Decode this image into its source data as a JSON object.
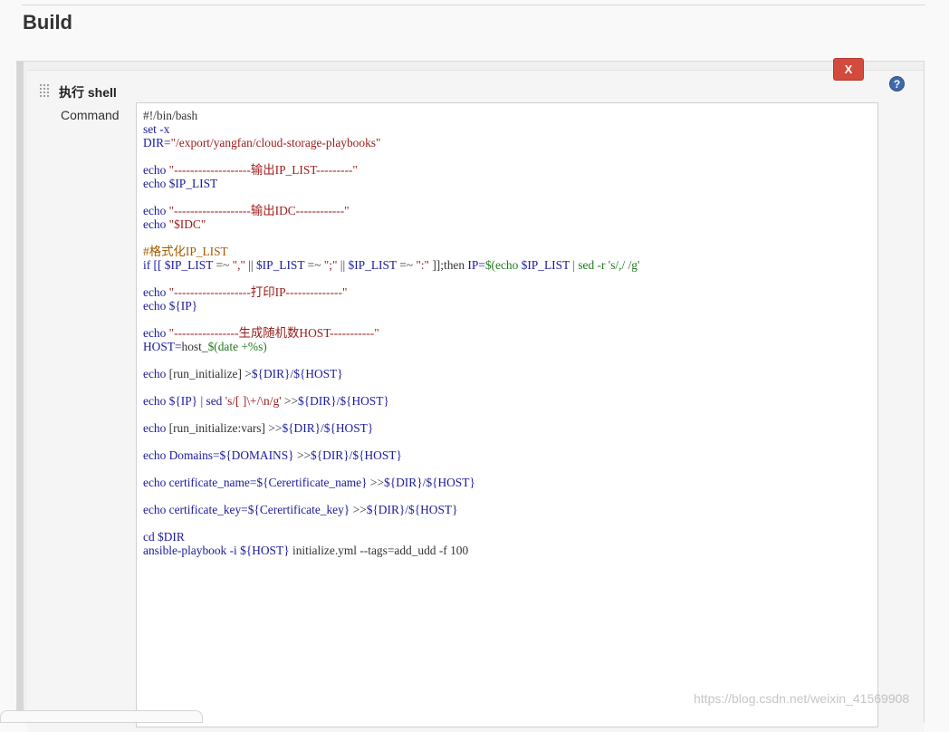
{
  "page": {
    "section_title": "Build"
  },
  "build_step": {
    "title": "执行 shell",
    "delete_label": "X",
    "help_label": "?",
    "field_label": "Command",
    "code_lines": [
      [
        [
          "p",
          "#!/bin/bash"
        ]
      ],
      [
        [
          "k",
          "set -x"
        ]
      ],
      [
        [
          "v",
          "DIR="
        ],
        [
          "s",
          "\"/export/yangfan/cloud-storage-playbooks\""
        ]
      ],
      [],
      [
        [
          "k",
          "echo "
        ],
        [
          "s",
          "\"-------------------输出IP_LIST---------\""
        ]
      ],
      [
        [
          "k",
          "echo "
        ],
        [
          "v",
          "$IP_LIST"
        ]
      ],
      [],
      [
        [
          "k",
          "echo "
        ],
        [
          "s",
          "\"-------------------输出IDC------------\""
        ]
      ],
      [
        [
          "k",
          "echo "
        ],
        [
          "s",
          "\"$IDC\""
        ]
      ],
      [],
      [
        [
          "c",
          "#格式化IP_LIST"
        ]
      ],
      [
        [
          "k",
          "if [[ "
        ],
        [
          "v",
          "$IP_LIST"
        ],
        [
          "p",
          " =~ "
        ],
        [
          "s",
          "\",\""
        ],
        [
          "p",
          " || "
        ],
        [
          "v",
          "$IP_LIST"
        ],
        [
          "p",
          " =~ "
        ],
        [
          "s",
          "\";\""
        ],
        [
          "p",
          " || "
        ],
        [
          "v",
          "$IP_LIST"
        ],
        [
          "p",
          " =~ "
        ],
        [
          "s",
          "\":\""
        ],
        [
          "p",
          " ]];then "
        ],
        [
          "v",
          "IP="
        ],
        [
          "g",
          "$(echo "
        ],
        [
          "v",
          "$IP_LIST"
        ],
        [
          "g",
          " | sed -r 's/,/ /g'"
        ]
      ],
      [],
      [
        [
          "k",
          "echo "
        ],
        [
          "s",
          "\"-------------------打印IP--------------\""
        ]
      ],
      [
        [
          "k",
          "echo "
        ],
        [
          "v",
          "${IP}"
        ]
      ],
      [],
      [
        [
          "k",
          "echo "
        ],
        [
          "s",
          "\"----------------生成随机数HOST-----------\""
        ]
      ],
      [
        [
          "v",
          "HOST="
        ],
        [
          "p",
          "host_"
        ],
        [
          "g",
          "$(date +%s)"
        ]
      ],
      [],
      [
        [
          "k",
          "echo "
        ],
        [
          "p",
          "[run_initialize] >"
        ],
        [
          "v",
          "${DIR}/${HOST}"
        ]
      ],
      [],
      [
        [
          "k",
          "echo "
        ],
        [
          "v",
          "${IP}"
        ],
        [
          "p",
          " | "
        ],
        [
          "k",
          "sed "
        ],
        [
          "s",
          "'s/[ ]\\+/\\n/g'"
        ],
        [
          "p",
          " >>"
        ],
        [
          "v",
          "${DIR}/${HOST}"
        ]
      ],
      [],
      [
        [
          "k",
          "echo "
        ],
        [
          "p",
          "[run_initialize:vars] >>"
        ],
        [
          "v",
          "${DIR}/${HOST}"
        ]
      ],
      [],
      [
        [
          "k",
          "echo "
        ],
        [
          "v",
          "Domains=${DOMAINS}"
        ],
        [
          "p",
          " >>"
        ],
        [
          "v",
          "${DIR}/${HOST}"
        ]
      ],
      [],
      [
        [
          "k",
          "echo "
        ],
        [
          "v",
          "certificate_name=${Cerertificate_name}"
        ],
        [
          "p",
          " >>"
        ],
        [
          "v",
          "${DIR}/${HOST}"
        ]
      ],
      [],
      [
        [
          "k",
          "echo "
        ],
        [
          "v",
          "certificate_key=${Cerertificate_key}"
        ],
        [
          "p",
          " >>"
        ],
        [
          "v",
          "${DIR}/${HOST}"
        ]
      ],
      [],
      [
        [
          "k",
          "cd "
        ],
        [
          "v",
          "$DIR"
        ]
      ],
      [
        [
          "v",
          "ansible-playbook -i ${HOST}"
        ],
        [
          "p",
          " initialize.yml --tags=add_udd -f 100"
        ]
      ]
    ]
  },
  "watermark": "https://blog.csdn.net/weixin_41569908",
  "colors": {
    "keyword": "#1a1a9e",
    "string": "#9c1a1a",
    "comment": "#a55a00",
    "command_subst": "#1e7a1e",
    "delete_button": "#d24b3c",
    "help_icon": "#3d6aa8"
  }
}
